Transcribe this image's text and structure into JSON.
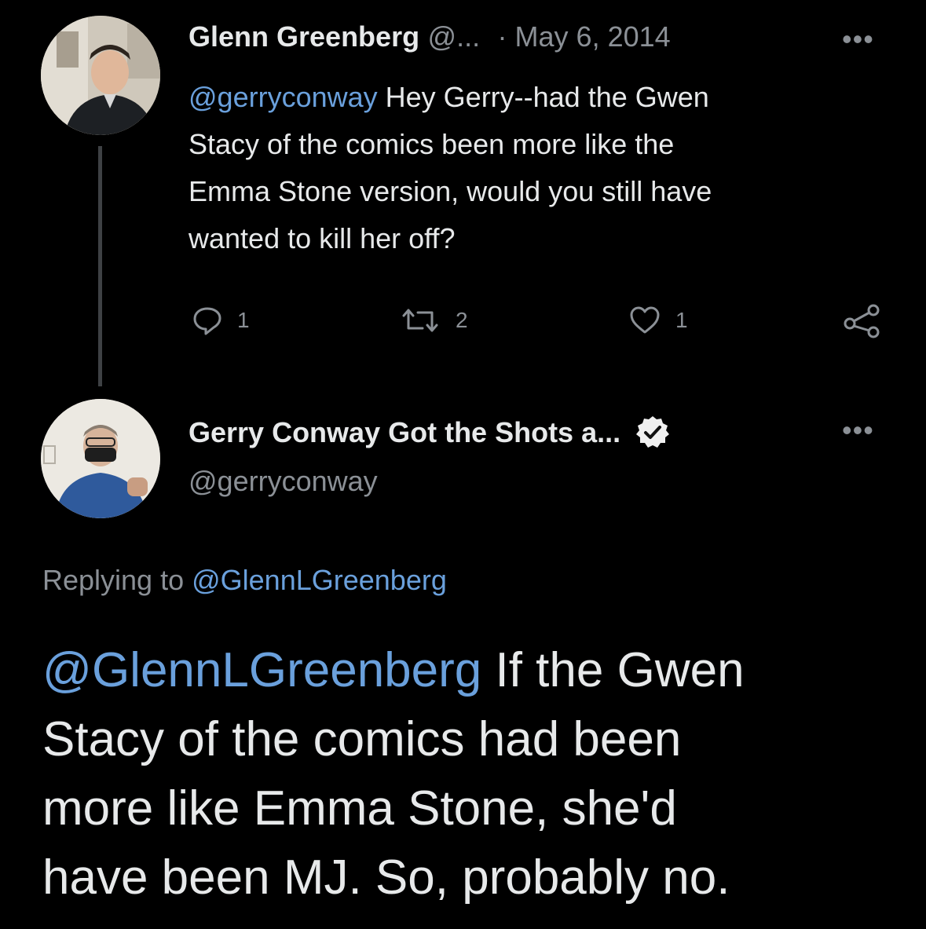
{
  "tweet1": {
    "author_name": "Glenn Greenberg",
    "handle_truncated": "@...",
    "date": "· May 6, 2014",
    "mention": "@gerryconway",
    "text_line1": " Hey Gerry--had the Gwen",
    "text_line2": "Stacy of the comics been more like the",
    "text_line3": "Emma Stone version, would you still have",
    "text_line4": "wanted to kill her off?",
    "more_icon": "•••",
    "replies": "1",
    "retweets": "2",
    "likes": "1"
  },
  "tweet2": {
    "author_name": "Gerry Conway Got the Shots a...",
    "handle": "@gerryconway",
    "more_icon": "•••",
    "replying_to_label": "Replying to ",
    "replying_to_handle": "@GlennLGreenberg",
    "mention": "@GlennLGreenberg",
    "text_line1": " If the Gwen",
    "text_line2": "Stacy of the comics had been",
    "text_line3": "more like Emma Stone, she'd",
    "text_line4": "have been MJ. So, probably no."
  },
  "colors": {
    "background": "#000000",
    "text": "#e7e9ea",
    "muted": "#8b9096",
    "link": "#6aa0dc"
  },
  "icons": [
    "reply-icon",
    "retweet-icon",
    "like-icon",
    "share-icon",
    "verified-badge-icon",
    "more-icon"
  ]
}
